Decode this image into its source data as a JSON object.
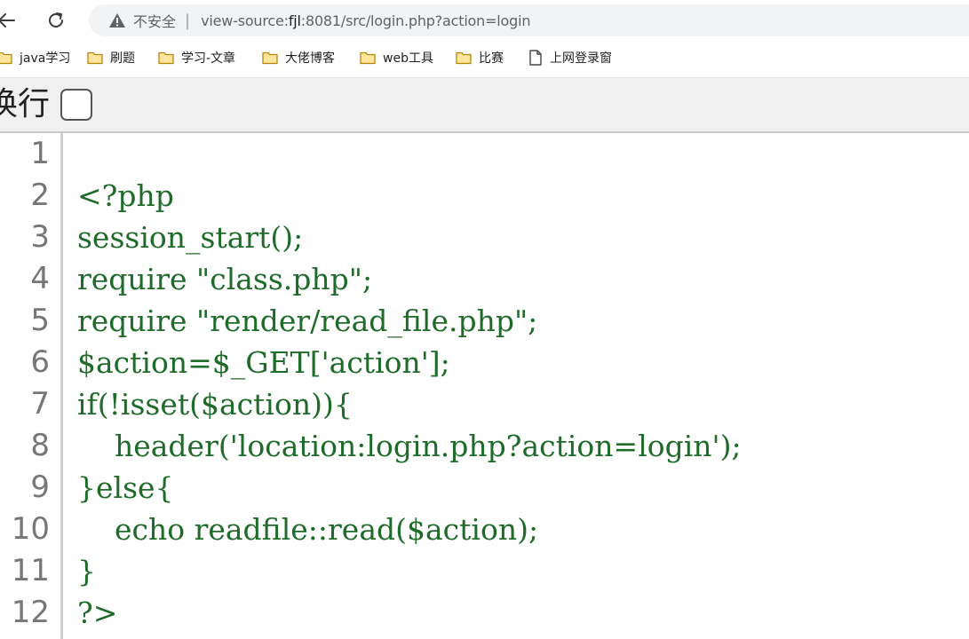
{
  "browser": {
    "security_label": "不安全",
    "url_prefix": "view-source:",
    "url_host": "fjl",
    "url_rest": ":8081/src/login.php?action=login"
  },
  "bookmarks": [
    {
      "label": "java学习",
      "icon": "folder-icon"
    },
    {
      "label": "刷题",
      "icon": "folder-icon"
    },
    {
      "label": "学习-文章",
      "icon": "folder-icon"
    },
    {
      "label": "大佬博客",
      "icon": "folder-icon"
    },
    {
      "label": "web工具",
      "icon": "folder-icon"
    },
    {
      "label": "比赛",
      "icon": "folder-icon"
    },
    {
      "label": "上网登录窗",
      "icon": "page-icon"
    }
  ],
  "toolbar": {
    "wrap_label": "换行",
    "wrap_checked": false
  },
  "source": {
    "line_numbers": [
      "1",
      "2",
      "3",
      "4",
      "5",
      "6",
      "7",
      "8",
      "9",
      "10",
      "11",
      "12"
    ],
    "lines": [
      "",
      "<?php",
      "session_start();",
      "require \"class.php\";",
      "require \"render/read_file.php\";",
      "$action=$_GET['action'];",
      "if(!isset($action)){",
      "    header('location:login.php?action=login');",
      "}else{",
      "    echo readfile::read($action);",
      "}",
      "?>"
    ]
  },
  "colors": {
    "code_text": "#1f6b2a",
    "line_number": "#777777",
    "toolbar_bg": "#f0f0f0"
  }
}
